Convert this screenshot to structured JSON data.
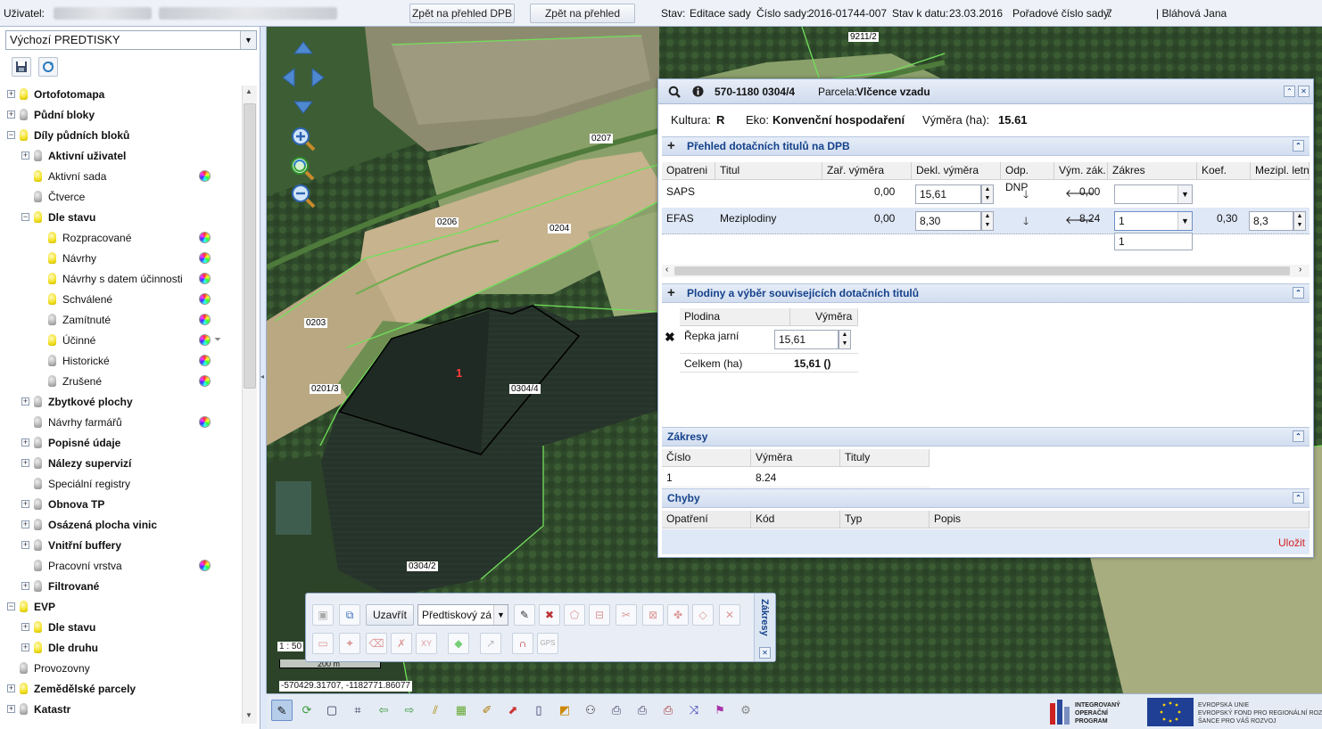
{
  "topbar": {
    "user_label": "Uživatel:",
    "btn_dpb": "Zpět na přehled DPB",
    "btn_changes": "Zpět na přehled změn",
    "stav_label": "Stav:",
    "stav_value": "Editace sady",
    "cislo_label": "Číslo sady:",
    "cislo_value": "2016-01744-007",
    "datum_label": "Stav k datu:",
    "datum_value": "23.03.2016",
    "poradi_label": "Pořadové číslo sady:",
    "poradi_value": "7",
    "user_name": "| Bláhová Jana"
  },
  "left": {
    "preset_select": "Výchozí PREDTISKY",
    "tree": [
      {
        "label": "Ortofotomapa",
        "bold": true,
        "level": 0,
        "pm": "+",
        "bulb": "on"
      },
      {
        "label": "Půdní bloky",
        "bold": true,
        "level": 0,
        "pm": "+",
        "bulb": "off"
      },
      {
        "label": "Díly půdních bloků",
        "bold": true,
        "level": 0,
        "pm": "-",
        "bulb": "on"
      },
      {
        "label": "Aktivní uživatel",
        "bold": true,
        "level": 1,
        "pm": "+",
        "bulb": "off"
      },
      {
        "label": "Aktivní sada",
        "bold": false,
        "level": 1,
        "pm": "",
        "bulb": "on",
        "wheel": true
      },
      {
        "label": "Čtverce",
        "bold": false,
        "level": 1,
        "pm": "",
        "bulb": "off"
      },
      {
        "label": "Dle stavu",
        "bold": true,
        "level": 1,
        "pm": "-",
        "bulb": "on"
      },
      {
        "label": "Rozpracované",
        "bold": false,
        "level": 2,
        "pm": "",
        "bulb": "on",
        "wheel": true
      },
      {
        "label": "Návrhy",
        "bold": false,
        "level": 2,
        "pm": "",
        "bulb": "on",
        "wheel": true
      },
      {
        "label": "Návrhy s datem účinnosti",
        "bold": false,
        "level": 2,
        "pm": "",
        "bulb": "on",
        "wheel": true
      },
      {
        "label": "Schválené",
        "bold": false,
        "level": 2,
        "pm": "",
        "bulb": "on",
        "wheel": true
      },
      {
        "label": "Zamítnuté",
        "bold": false,
        "level": 2,
        "pm": "",
        "bulb": "off",
        "wheel": true
      },
      {
        "label": "Účinné",
        "bold": false,
        "level": 2,
        "pm": "",
        "bulb": "on",
        "wheel": true,
        "filter": true
      },
      {
        "label": "Historické",
        "bold": false,
        "level": 2,
        "pm": "",
        "bulb": "off",
        "wheel": true
      },
      {
        "label": "Zrušené",
        "bold": false,
        "level": 2,
        "pm": "",
        "bulb": "off",
        "wheel": true
      },
      {
        "label": "Zbytkové plochy",
        "bold": true,
        "level": 1,
        "pm": "+",
        "bulb": "off"
      },
      {
        "label": "Návrhy farmářů",
        "bold": false,
        "level": 1,
        "pm": "",
        "bulb": "off",
        "wheel": true
      },
      {
        "label": "Popisné údaje",
        "bold": true,
        "level": 1,
        "pm": "+",
        "bulb": "off"
      },
      {
        "label": "Nálezy supervizí",
        "bold": true,
        "level": 1,
        "pm": "+",
        "bulb": "off"
      },
      {
        "label": "Speciální registry",
        "bold": false,
        "level": 1,
        "pm": "",
        "bulb": "off"
      },
      {
        "label": "Obnova TP",
        "bold": true,
        "level": 1,
        "pm": "+",
        "bulb": "off"
      },
      {
        "label": "Osázená plocha vinic",
        "bold": true,
        "level": 1,
        "pm": "+",
        "bulb": "off"
      },
      {
        "label": "Vnitřní buffery",
        "bold": true,
        "level": 1,
        "pm": "+",
        "bulb": "off"
      },
      {
        "label": "Pracovní vrstva",
        "bold": false,
        "level": 1,
        "pm": "",
        "bulb": "off",
        "wheel": true
      },
      {
        "label": "Filtrované",
        "bold": true,
        "level": 1,
        "pm": "+",
        "bulb": "off"
      },
      {
        "label": "EVP",
        "bold": true,
        "level": 0,
        "pm": "-",
        "bulb": "on"
      },
      {
        "label": "Dle stavu",
        "bold": true,
        "level": 1,
        "pm": "+",
        "bulb": "on"
      },
      {
        "label": "Dle druhu",
        "bold": true,
        "level": 1,
        "pm": "+",
        "bulb": "on"
      },
      {
        "label": "Provozovny",
        "bold": false,
        "level": 0,
        "pm": "",
        "bulb": "off"
      },
      {
        "label": "Zemědělské parcely",
        "bold": true,
        "level": 0,
        "pm": "+",
        "bulb": "on"
      },
      {
        "label": "Katastr",
        "bold": true,
        "level": 0,
        "pm": "+",
        "bulb": "off"
      }
    ]
  },
  "map": {
    "labels": [
      "9211/2",
      "0207",
      "0206",
      "0204",
      "0203",
      "0201/3",
      "0304/4",
      "0304/2"
    ],
    "selected_num": "1",
    "scale": "1 : 50",
    "scalebar": "200 m",
    "coords": "-570429.31707, -1182771.86077"
  },
  "popup": {
    "block_id": "570-1180 0304/4",
    "parcela_label": "Parcela:",
    "parcela_value": "Vlčence vzadu",
    "kultura_label": "Kultura:",
    "kultura_value": "R",
    "eko_label": "Eko:",
    "eko_value": "Konvenční hospodaření",
    "vymera_label": "Výměra (ha):",
    "vymera_value": "15.61",
    "sec1_title": "Přehled dotačních titulů na DPB",
    "sec1_cols": [
      "Opatreni",
      "Titul",
      "Zař. výměra",
      "Dekl. výměra",
      "Odp. DNP",
      "Vým. zák.",
      "Zákres",
      "Koef.",
      "Mezipl. letní (ha"
    ],
    "sec1_rows": [
      {
        "opatreni": "SAPS",
        "titul": "",
        "zar": "0,00",
        "dekl": "15,61",
        "vym_zak": "0,00",
        "zakres": "",
        "koef": "",
        "mezipl": ""
      },
      {
        "opatreni": "EFAS",
        "titul": "Meziplodiny",
        "zar": "0,00",
        "dekl": "8,30",
        "vym_zak": "8,24",
        "zakres": "1",
        "koef": "0,30",
        "mezipl": "8,3"
      }
    ],
    "dropdown_option": "1",
    "sec2_title": "Plodiny a výběr souvisejících dotačních titulů",
    "sec2_cols": [
      "Plodina",
      "Výměra"
    ],
    "sec2_row": {
      "plodina": "Řepka jarní",
      "vymera": "15,61"
    },
    "celkem_label": "Celkem (ha)",
    "celkem_value": "15,61 ()",
    "sec3_title": "Zákresy",
    "sec3_cols": [
      "Číslo",
      "Výměra",
      "Tituly"
    ],
    "sec3_row": {
      "cislo": "1",
      "vymera": "8.24",
      "tituly": ""
    },
    "sec4_title": "Chyby",
    "sec4_cols": [
      "Opatření",
      "Kód",
      "Typ",
      "Popis"
    ],
    "save": "Uložit"
  },
  "edit_toolbar": {
    "close_btn": "Uzavřít",
    "select_value": "Předtiskový zá",
    "side_title": "Zákresy"
  },
  "footer": {
    "iop_lines": [
      "INTEGROVANÝ",
      "OPERAČNÍ",
      "PROGRAM"
    ],
    "eu_lines": [
      "EVROPSKÁ UNIE",
      "EVROPSKÝ FOND PRO REGIONÁLNÍ ROZ",
      "ŠANCE PRO VÁŠ ROZVOJ"
    ]
  }
}
